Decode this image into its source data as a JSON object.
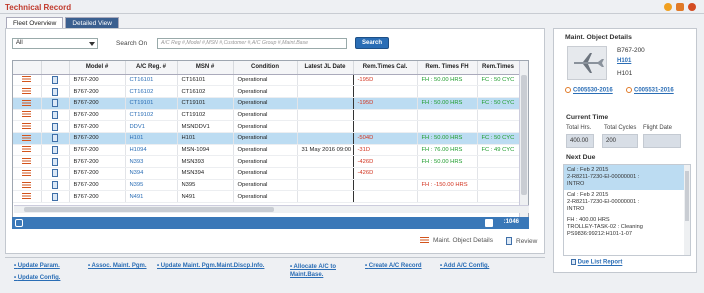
{
  "app": {
    "title": "Technical Record"
  },
  "tabs": [
    {
      "label": "Fleet Overview",
      "active": true
    },
    {
      "label": "Detailed View",
      "active": false
    }
  ],
  "filter": {
    "selected": "All",
    "search_label": "Search On",
    "search_placeholder": "A/C Reg #,Model #,MSN #,Customer #,A/C Group #,Maint.Base",
    "search_button": "Search"
  },
  "grid": {
    "columns": [
      "",
      "",
      "Model #",
      "A/C Reg. #",
      "MSN #",
      "Condition",
      "Latest JL Date",
      "Rem.Times Cal.",
      "Rem. Times FH",
      "Rem.Times"
    ],
    "rows": [
      {
        "model": "B767-200",
        "reg": "CT16101",
        "msn": "CT16101",
        "cond": "Operational",
        "jl": "",
        "cal": "-195D",
        "fh": "FH : 50.00 HRS",
        "cyc": "FC : 50 CYC",
        "selected": false
      },
      {
        "model": "B767-200",
        "reg": "CT16102",
        "msn": "CT16102",
        "cond": "Operational",
        "jl": "",
        "cal": "",
        "fh": "",
        "cyc": "",
        "selected": false
      },
      {
        "model": "B767-200",
        "reg": "CT19101",
        "msn": "CT19101",
        "cond": "Operational",
        "jl": "",
        "cal": "-195D",
        "fh": "FH : 50.00 HRS",
        "cyc": "FC : 50 CYC",
        "selected": true
      },
      {
        "model": "B767-200",
        "reg": "CT19102",
        "msn": "CT19102",
        "cond": "Operational",
        "jl": "",
        "cal": "",
        "fh": "",
        "cyc": "",
        "selected": false
      },
      {
        "model": "B767-200",
        "reg": "DDV1",
        "msn": "MSNDDV1",
        "cond": "Operational",
        "jl": "",
        "cal": "",
        "fh": "",
        "cyc": "",
        "selected": false
      },
      {
        "model": "B767-200",
        "reg": "H101",
        "msn": "H101",
        "cond": "Operational",
        "jl": "",
        "cal": "-504D",
        "fh": "FH : 50.00 HRS",
        "cyc": "FC : 50 CYC",
        "selected": true
      },
      {
        "model": "B767-200",
        "reg": "H1094",
        "msn": "MSN-1094",
        "cond": "Operational",
        "jl": "31 May 2016 09:00",
        "cal": "-31D",
        "fh": "FH : 76.00 HRS",
        "cyc": "FC : 49 CYC",
        "selected": false
      },
      {
        "model": "B767-200",
        "reg": "N393",
        "msn": "MSN393",
        "cond": "Operational",
        "jl": "",
        "cal": "-426D",
        "fh": "FH : 50.00 HRS",
        "cyc": "",
        "selected": false
      },
      {
        "model": "B767-200",
        "reg": "N394",
        "msn": "MSN394",
        "cond": "Operational",
        "jl": "",
        "cal": "-426D",
        "fh": "",
        "cyc": "",
        "selected": false
      },
      {
        "model": "B767-200",
        "reg": "N395",
        "msn": "N395",
        "cond": "Operational",
        "jl": "",
        "cal": "",
        "fh": "FH : -150.00 HRS",
        "cyc": "",
        "selected": false
      },
      {
        "model": "B767-200",
        "reg": "N491",
        "msn": "N491",
        "cond": "Operational",
        "jl": "",
        "cal": "",
        "fh": "",
        "cyc": "",
        "selected": false
      }
    ],
    "record_count": ":1046"
  },
  "links": {
    "maint_object_details": "Maint. Object Details",
    "review": "Review"
  },
  "bottom_links": [
    "Update Param.",
    "Assoc. Maint. Pgm.",
    "Update Maint. Pgm.Maint.Discp.Info.",
    "Allocate A/C to Maint.Base.",
    "Create A/C Record",
    "Add A/C Config.",
    "Update Config."
  ],
  "details": {
    "title": "Maint. Object Details",
    "model": "B767-200",
    "reg": "H101",
    "msn": "H101",
    "link1": "C005530-2016",
    "link2": "C005531-2016",
    "current_time_title": "Current Time",
    "total_hrs_label": "Total Hrs.",
    "total_cycles_label": "Total Cycles",
    "flight_date_label": "Flight Date",
    "total_hrs": "400.00",
    "total_cycles": "200",
    "flight_date": "",
    "next_due_title": "Next Due",
    "next_due": [
      {
        "lines": [
          "Cal : Feb 2 2015",
          "2-R8211-7230-EI-00000001 :",
          "INTRO"
        ],
        "selected": true
      },
      {
        "lines": [
          "Cal : Feb 2 2015",
          "2-R8211-7230-EI-00000001 :",
          "INTRO"
        ],
        "selected": false
      },
      {
        "lines": [
          "FH : 400.00 HRS",
          "TROLLEY-TASK-02 : Cleaning",
          "PS9836:99212:H101-1-07"
        ],
        "selected": false
      }
    ],
    "due_list_report": "Due List Report"
  }
}
